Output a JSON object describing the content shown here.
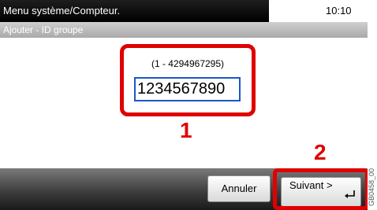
{
  "header": {
    "title": "Menu système/Compteur.",
    "time": "10:10"
  },
  "subheader": {
    "title": "Ajouter - ID groupe"
  },
  "form": {
    "range": "(1 - 4294967295)",
    "value": "1234567890"
  },
  "callouts": {
    "step1": "1",
    "step2": "2"
  },
  "buttons": {
    "cancel": "Annuler",
    "next": "Suivant >"
  },
  "side_label": "GB0458_00",
  "colors": {
    "callout": "#e00000",
    "input_border": "#1b57c8"
  }
}
